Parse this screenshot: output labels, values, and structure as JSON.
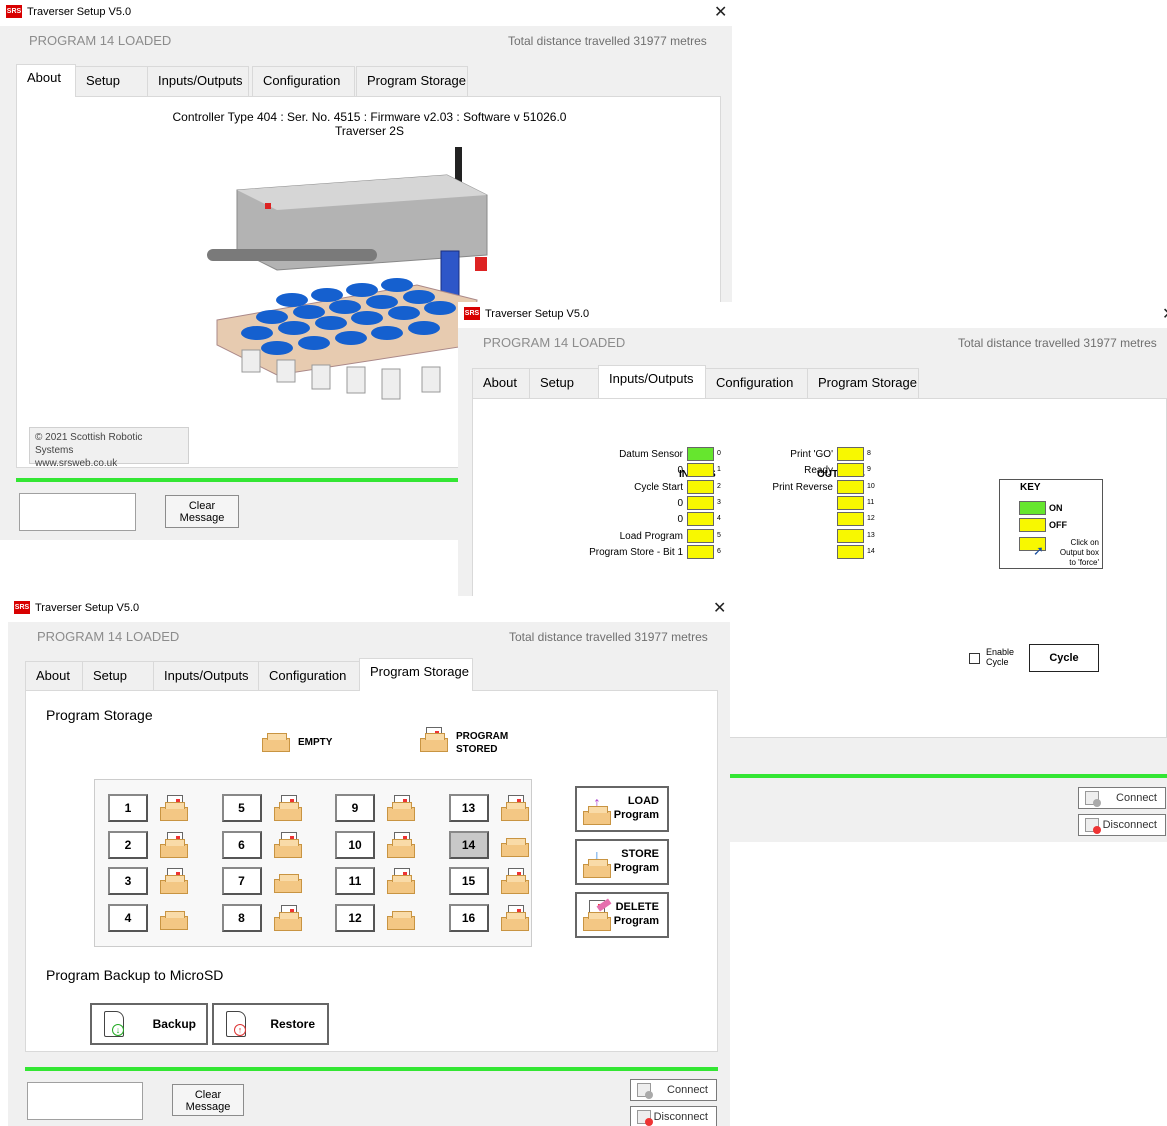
{
  "window_title": "Traverser Setup V5.0",
  "app_icon": "SRS",
  "close_glyph": "✕",
  "status_left": "PROGRAM  14  LOADED",
  "status_right": "Total distance travelled 31977 metres",
  "tabs": [
    "About",
    "Setup",
    "Inputs/Outputs",
    "Configuration",
    "Program Storage"
  ],
  "clear_message": "Clear\nMessage",
  "connect": "Connect",
  "disconnect": "Disconnect",
  "about": {
    "controller_info": "Controller Type 404 : Ser. No. 4515 : Firmware v2.03 : Software v 51026.0",
    "model": "Traverser 2S",
    "copyright": "© 2021 Scottish Robotic Systems",
    "website": "www.srsweb.co.uk"
  },
  "io": {
    "inputs_title": "INPUTS",
    "outputs_title": "OUTPUTS",
    "inputs": [
      {
        "label": "Datum Sensor",
        "num": "0",
        "state": "on"
      },
      {
        "label": "0",
        "num": "1",
        "state": "off"
      },
      {
        "label": "Cycle Start",
        "num": "2",
        "state": "off"
      },
      {
        "label": "0",
        "num": "3",
        "state": "off"
      },
      {
        "label": "0",
        "num": "4",
        "state": "off"
      },
      {
        "label": "Load Program",
        "num": "5",
        "state": "off"
      },
      {
        "label": "Program Store - Bit 1",
        "num": "6",
        "state": "off"
      }
    ],
    "outputs": [
      {
        "label": "Print 'GO'",
        "num": "8",
        "state": "off"
      },
      {
        "label": "Ready",
        "num": "9",
        "state": "off"
      },
      {
        "label": "Print Reverse",
        "num": "10",
        "state": "off"
      },
      {
        "label": "",
        "num": "11",
        "state": "off"
      },
      {
        "label": "",
        "num": "12",
        "state": "off"
      },
      {
        "label": "",
        "num": "13",
        "state": "off"
      },
      {
        "label": "",
        "num": "14",
        "state": "off"
      }
    ],
    "key_title": "KEY",
    "key_on": "ON",
    "key_off": "OFF",
    "key_force": "Click on\nOutput box\nto 'force'",
    "enable_cycle": "Enable\nCycle",
    "cycle_button": "Cycle",
    "colors": {
      "on": "#66e62e",
      "off": "#f8f800"
    }
  },
  "storage": {
    "heading": "Program Storage",
    "legend_empty": "EMPTY",
    "legend_stored": "PROGRAM\nSTORED",
    "slots": [
      {
        "n": "1",
        "stored": true
      },
      {
        "n": "2",
        "stored": true
      },
      {
        "n": "3",
        "stored": true
      },
      {
        "n": "4",
        "stored": false
      },
      {
        "n": "5",
        "stored": true
      },
      {
        "n": "6",
        "stored": true
      },
      {
        "n": "7",
        "stored": false
      },
      {
        "n": "8",
        "stored": true
      },
      {
        "n": "9",
        "stored": true
      },
      {
        "n": "10",
        "stored": true
      },
      {
        "n": "11",
        "stored": true
      },
      {
        "n": "12",
        "stored": false
      },
      {
        "n": "13",
        "stored": true
      },
      {
        "n": "14",
        "stored": false,
        "selected": true
      },
      {
        "n": "15",
        "stored": true
      },
      {
        "n": "16",
        "stored": true
      }
    ],
    "load_btn": "LOAD\nProgram",
    "store_btn": "STORE\nProgram",
    "delete_btn": "DELETE\nProgram",
    "backup_heading": "Program Backup to MicroSD",
    "backup_btn": "Backup",
    "restore_btn": "Restore"
  }
}
